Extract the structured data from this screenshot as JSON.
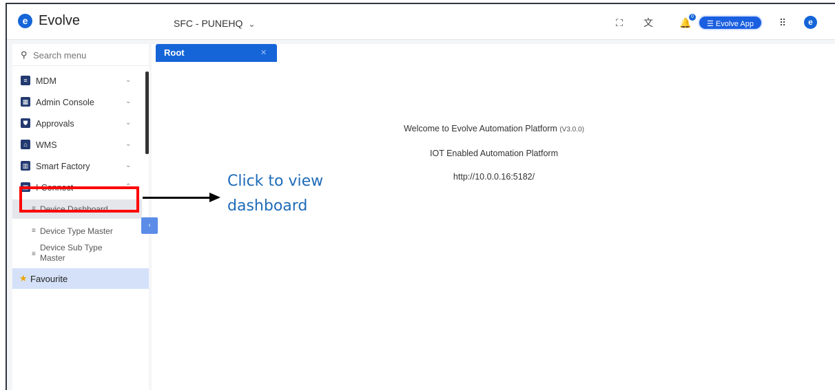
{
  "header": {
    "brand": "Evolve",
    "logo_letter": "e",
    "plant": "SFC - PUNEHQ",
    "notification_count": "0",
    "evolve_app_label": "Evolve App",
    "icons": [
      "fullscreen-icon",
      "translate-icon",
      "bell-icon",
      "apps-grid-icon"
    ]
  },
  "sidebar": {
    "search_placeholder": "Search menu",
    "items": [
      {
        "label": "MDM",
        "icon": "database-icon"
      },
      {
        "label": "Admin Console",
        "icon": "grid-icon"
      },
      {
        "label": "Approvals",
        "icon": "shield-icon"
      },
      {
        "label": "WMS",
        "icon": "warehouse-icon"
      },
      {
        "label": "Smart Factory",
        "icon": "factory-icon"
      },
      {
        "label": "I-Connect",
        "icon": "device-icon"
      }
    ],
    "sub_items": [
      {
        "label": "Device Dashboard"
      },
      {
        "label": "Device Type Master"
      },
      {
        "label": "Device Sub Type Master",
        "line1": "Device Sub Type",
        "line2": "Master"
      }
    ],
    "favourite": "Favourite"
  },
  "main": {
    "tab": "Root",
    "welcome_line": "Welcome to Evolve Automation Platform",
    "version": "(V3.0.0)",
    "subtitle": "IOT Enabled Automation Platform",
    "url": "http://10.0.0.16:5182/"
  },
  "annotation": {
    "line1": "Click to view",
    "line2": "dashboard"
  },
  "colors": {
    "accent": "#1565d8",
    "highlight": "#ff0000",
    "annotation_text": "#1e6bb8",
    "favourite_bg": "#d4e1f8"
  }
}
